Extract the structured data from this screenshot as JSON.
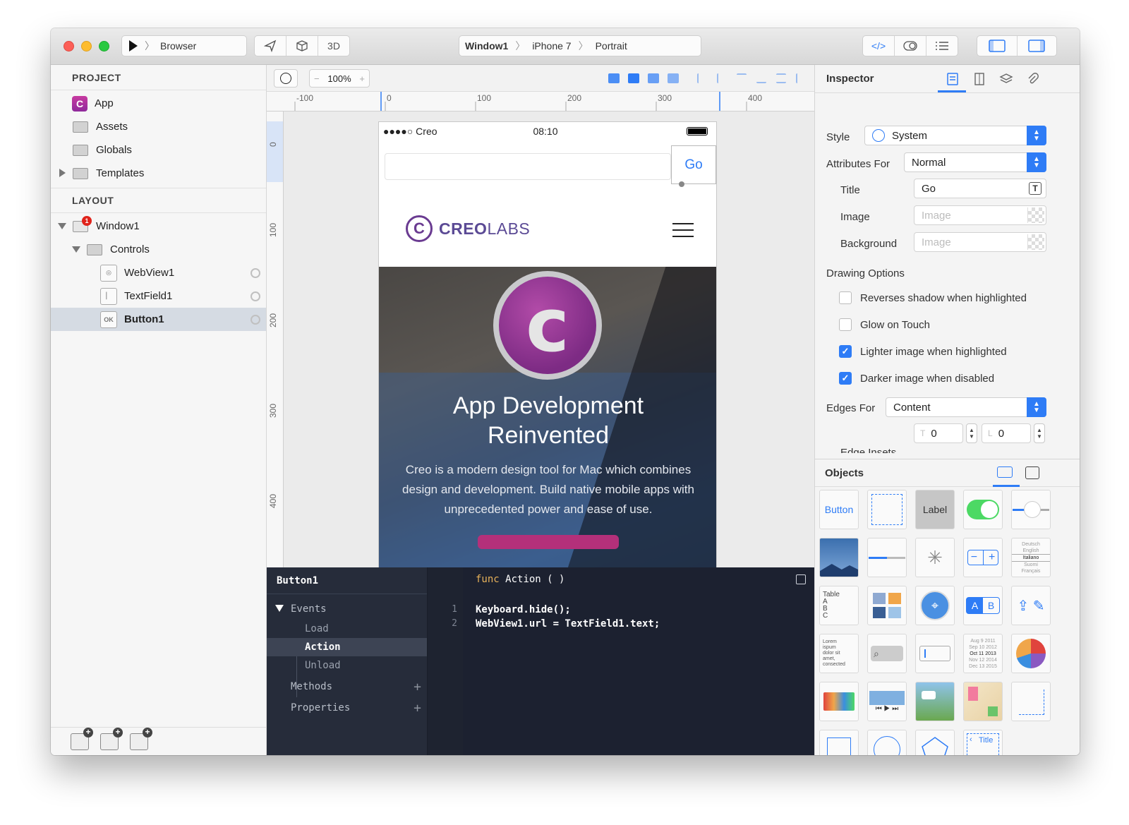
{
  "titlebar": {
    "scheme_label": "Browser",
    "view_3d_label": "3D",
    "breadcrumb": [
      "Window1",
      "iPhone 7",
      "Portrait"
    ]
  },
  "project": {
    "heading": "PROJECT",
    "items": [
      {
        "label": "App",
        "icon": "app-icon"
      },
      {
        "label": "Assets",
        "icon": "folder-icon"
      },
      {
        "label": "Globals",
        "icon": "folder-icon"
      },
      {
        "label": "Templates",
        "icon": "folder-icon"
      }
    ]
  },
  "layout": {
    "heading": "LAYOUT",
    "window_label": "Window1",
    "window_badge": "1",
    "controls_label": "Controls",
    "children": [
      {
        "label": "WebView1",
        "icon": "webview-icon"
      },
      {
        "label": "TextField1",
        "icon": "textfield-icon"
      },
      {
        "label": "Button1",
        "icon": "button-icon",
        "icon_text": "OK"
      }
    ]
  },
  "canvas_toolbar": {
    "zoom": "100%",
    "minus": "−",
    "plus": "+"
  },
  "ruler": {
    "top_labels": [
      "-100",
      "0",
      "100",
      "200",
      "300",
      "400"
    ],
    "left_labels": [
      "0",
      "100",
      "200",
      "300",
      "400"
    ]
  },
  "phone": {
    "carrier": "●●●●○ Creo",
    "time": "08:10",
    "go_button": "Go",
    "logo_mark": "C",
    "logo_bold": "CREO",
    "logo_light": "LABS",
    "hero_mark": "c",
    "hero_title_1": "App Development",
    "hero_title_2": "Reinvented",
    "hero_desc": "Creo is a modern design tool for Mac which combines design and development. Build native mobile apps with unprecedented power and ease of use."
  },
  "code": {
    "object_name": "Button1",
    "events_label": "Events",
    "events": [
      "Load",
      "Action",
      "Unload"
    ],
    "methods_label": "Methods",
    "properties_label": "Properties",
    "func_keyword": "func",
    "func_name": "Action",
    "func_parens": "(  )",
    "lines": [
      {
        "num": "1",
        "text": "Keyboard.hide();"
      },
      {
        "num": "2",
        "text": "WebView1.url = TextField1.text;"
      }
    ]
  },
  "inspector": {
    "title": "Inspector",
    "style_label": "Style",
    "style_value": "System",
    "attributes_label": "Attributes For",
    "attributes_value": "Normal",
    "title_label": "Title",
    "title_value": "Go",
    "image_label": "Image",
    "image_placeholder": "Image",
    "background_label": "Background",
    "background_placeholder": "Image",
    "drawing_options_label": "Drawing Options",
    "checkboxes": [
      {
        "label": "Reverses shadow when highlighted",
        "checked": false
      },
      {
        "label": "Glow on Touch",
        "checked": false
      },
      {
        "label": "Lighter image when highlighted",
        "checked": true
      },
      {
        "label": "Darker image when disabled",
        "checked": true
      }
    ],
    "edges_label": "Edges For",
    "edges_value": "Content",
    "edge_t_prefix": "T",
    "edge_t_value": "0",
    "edge_l_prefix": "L",
    "edge_l_value": "0",
    "edge_insets_label": "Edge Insets"
  },
  "objects": {
    "heading": "Objects",
    "button_label": "Button",
    "label_label": "Label",
    "table_label": "Table",
    "table_rows": [
      "A",
      "B",
      "C"
    ],
    "textview_lines": [
      "Lorem",
      "ispum",
      "dolor sit",
      "amet,",
      "consected"
    ],
    "picker_rows": [
      "Deutsch",
      "English",
      "Italiano",
      "Suomi",
      "Français"
    ],
    "date_rows": [
      "Aug  9  2011",
      "Sep 10  2012",
      "Oct 11 2013",
      "Nov 12 2014",
      "Dec 13 2015"
    ],
    "nav_title": "Title",
    "segment_a": "A",
    "segment_b": "B"
  },
  "colors": {
    "accent": "#2e7cf6",
    "brand_purple": "#6a3b91",
    "code_bg": "#1c2130"
  }
}
